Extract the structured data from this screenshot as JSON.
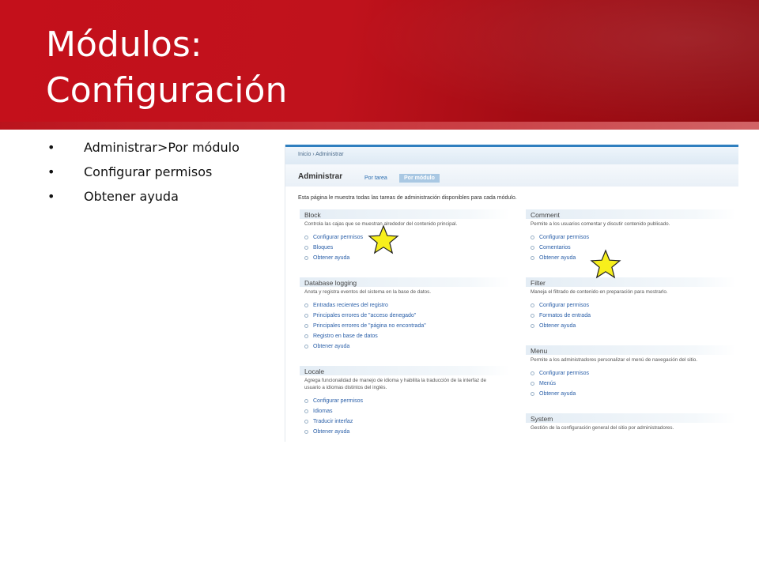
{
  "slide": {
    "title_line1": "Módulos:",
    "title_line2": "Configuración"
  },
  "bullets": [
    "Administrar>Por módulo",
    "Configurar permisos",
    "Obtener ayuda"
  ],
  "screenshot": {
    "breadcrumb": "Inicio › Administrar",
    "page_title": "Administrar",
    "tabs": [
      "Por tarea",
      "Por módulo"
    ],
    "intro": "Esta página le muestra todas las tareas de administración disponibles para cada módulo.",
    "modules": {
      "block": {
        "title": "Block",
        "description": "Controla las cajas que se muestran alrededor del contenido principal.",
        "links": [
          "Configurar permisos",
          "Bloques",
          "Obtener ayuda"
        ]
      },
      "dblog": {
        "title": "Database logging",
        "description": "Anota y registra eventos del sistema en la base de datos.",
        "links": [
          "Entradas recientes del registro",
          "Principales errores de \"acceso denegado\"",
          "Principales errores de \"página no encontrada\"",
          "Registro en base de datos",
          "Obtener ayuda"
        ]
      },
      "locale": {
        "title": "Locale",
        "description": "Agrega funcionalidad de manejo de idioma y habilita la traducción de la interfaz de usuario a idiomas distintos del inglés.",
        "links": [
          "Configurar permisos",
          "Idiomas",
          "Traducir interfaz",
          "Obtener ayuda"
        ]
      },
      "comment": {
        "title": "Comment",
        "description": "Permite a los usuarios comentar y discutir contenido publicado.",
        "links": [
          "Configurar permisos",
          "Comentarios",
          "Obtener ayuda"
        ]
      },
      "filter": {
        "title": "Filter",
        "description": "Maneja el filtrado de contenido en preparación para mostrarlo.",
        "links": [
          "Configurar permisos",
          "Formatos de entrada",
          "Obtener ayuda"
        ]
      },
      "menu": {
        "title": "Menu",
        "description": "Permite a los administradores personalizar el menú de navegación del sitio.",
        "links": [
          "Configurar permisos",
          "Menús",
          "Obtener ayuda"
        ]
      },
      "system": {
        "title": "System",
        "description": "Gestión de la configuración general del sitio por administradores."
      }
    }
  },
  "colors": {
    "header_red": "#c4101b",
    "link_blue": "#2a5fa8",
    "star_yellow": "#f7ef1c"
  }
}
